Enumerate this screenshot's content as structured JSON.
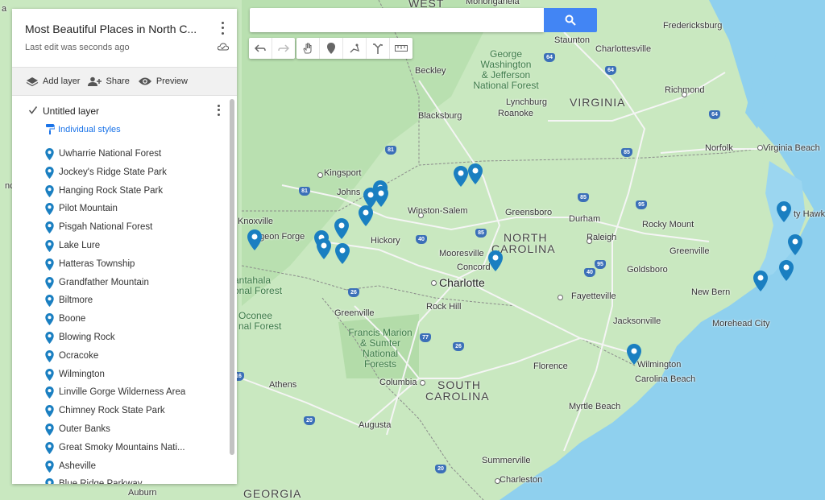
{
  "panel": {
    "title": "Most Beautiful Places in North C...",
    "subtitle": "Last edit was seconds ago",
    "actions": {
      "add_layer": "Add layer",
      "share": "Share",
      "preview": "Preview"
    },
    "layer": {
      "name": "Untitled layer",
      "styles_label": "Individual styles",
      "checked": true,
      "items": [
        "Uwharrie National Forest",
        "Jockey's Ridge State Park",
        "Hanging Rock State Park",
        "Pilot Mountain",
        "Pisgah National Forest",
        "Lake Lure",
        "Hatteras Township",
        "Grandfather Mountain",
        "Biltmore",
        "Boone",
        "Blowing Rock",
        "Ocracoke",
        "Wilmington",
        "Linville Gorge Wilderness Area",
        "Chimney Rock State Park",
        "Outer Banks",
        "Great Smoky Mountains Nati...",
        "Asheville",
        "Blue Ridge Parkway"
      ]
    }
  },
  "search": {
    "placeholder": ""
  },
  "toolbar": {
    "icons": [
      "undo-icon",
      "redo-icon",
      "hand-icon",
      "marker-icon",
      "draw-line-icon",
      "directions-icon",
      "ruler-icon"
    ]
  },
  "colors": {
    "pin": "#1a7fc1",
    "water": "#8fd0ee",
    "land": "#c9e8c0",
    "search_button": "#4285f4"
  },
  "map": {
    "states": {
      "west": "WEST",
      "virginia": "VIRGINIA",
      "nc1": "NORTH",
      "nc2": "CAROLINA",
      "sc1": "SOUTH",
      "sc2": "CAROLINA",
      "georgia": "GEORGIA"
    },
    "cities": {
      "monongahela": "Monongahela",
      "fredericksburg": "Fredericksburg",
      "staunton": "Staunton",
      "charlottesville": "Charlottesville",
      "richmond": "Richmond",
      "beckley": "Beckley",
      "lynchburg": "Lynchburg",
      "roanoke": "Roanoke",
      "blacksburg": "Blacksburg",
      "norfolk": "Norfolk",
      "virginia_beach": "Virginia Beach",
      "kingsport": "Kingsport",
      "johnson": "Johns",
      "winston_salem": "Winston-Salem",
      "greensboro": "Greensboro",
      "durham": "Durham",
      "rocky_mount": "Rocky Mount",
      "kitty_hawk": "ty Hawk",
      "knoxville": "Knoxville",
      "pigeon_forge": "geon Forge",
      "hickory": "Hickory",
      "raleigh": "Raleigh",
      "greenville_nc": "Greenville",
      "mooresville": "Mooresville",
      "concord": "Concord",
      "goldsboro": "Goldsboro",
      "charlotte": "Charlotte",
      "new_bern": "New Bern",
      "fayetteville": "Fayetteville",
      "rock_hill": "Rock Hill",
      "greenville_sc": "Greenville",
      "jacksonville": "Jacksonville",
      "morehead_city": "Morehead City",
      "wilmington": "Wilmington",
      "carolina_beach": "Carolina Beach",
      "florence": "Florence",
      "columbia": "Columbia",
      "athens": "Athens",
      "myrtle_beach": "Myrtle Beach",
      "augusta": "Augusta",
      "summerville": "Summerville",
      "charleston": "Charleston",
      "auburn": "Auburn",
      "a_partial": "a",
      "nc_partial": "nc"
    },
    "regions": {
      "gw1": "George",
      "gw2": "Washington",
      "gw3": "& Jefferson",
      "gw4": "National Forest",
      "nan1": "antahala",
      "nan2": "onal Forest",
      "oco1": "Oconee",
      "oco2": "nal Forest",
      "fm1": "Francis Marion",
      "fm2": "& Sumter",
      "fm3": "National",
      "fm4": "Forests"
    },
    "shields": {
      "s64a": "64",
      "s64b": "64",
      "s64c": "64",
      "s81a": "81",
      "s81b": "81",
      "s85a": "85",
      "s85b": "85",
      "s85c": "85",
      "s95a": "95",
      "s95b": "95",
      "s40a": "40",
      "s40b": "40",
      "s26a": "26",
      "s26b": "26",
      "s77": "77",
      "s20a": "20",
      "s20b": "20",
      "s16": "16"
    }
  }
}
